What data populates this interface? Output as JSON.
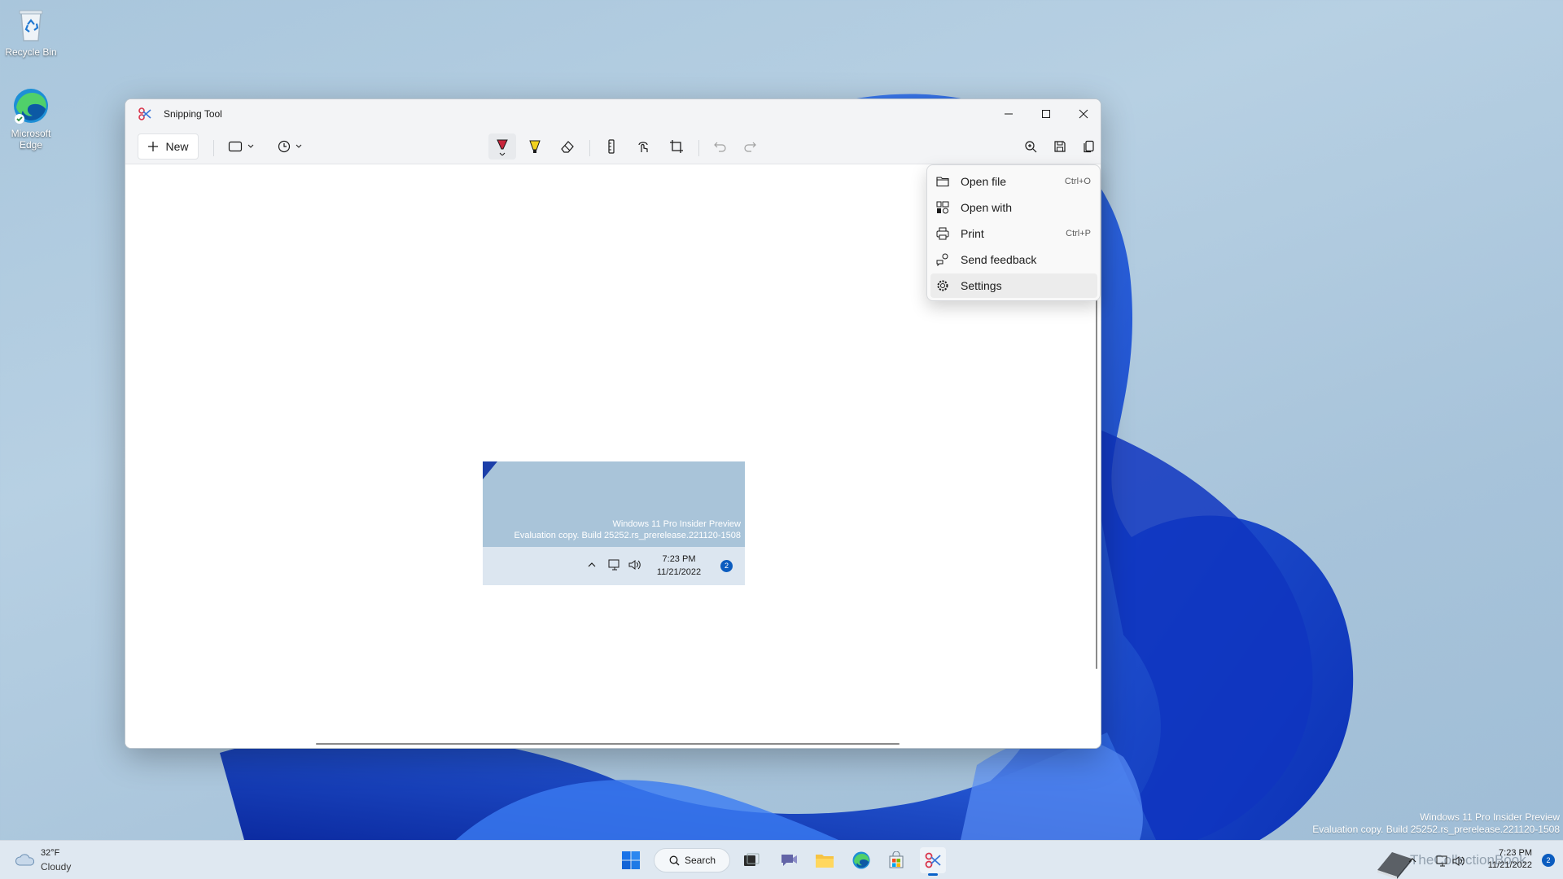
{
  "desktop": {
    "icons": [
      {
        "label": "Recycle Bin",
        "icon": "recycle-bin-icon"
      },
      {
        "label": "Microsoft Edge",
        "icon": "edge-icon"
      }
    ],
    "watermark_line1": "Windows 11 Pro Insider Preview",
    "watermark_line2": "Evaluation copy. Build 25252.rs_prerelease.221120-1508",
    "logo_text": "TheCollectionBook"
  },
  "window": {
    "title": "Snipping Tool",
    "toolbar": {
      "new_label": "New",
      "icons": [
        "snip-mode-icon",
        "delay-timer-icon",
        "ballpoint-pen-icon",
        "highlighter-icon",
        "eraser-icon",
        "ruler-icon",
        "touch-writing-icon",
        "crop-icon",
        "undo-icon",
        "redo-icon",
        "zoom-icon",
        "save-icon",
        "copy-icon",
        "share-icon",
        "more-icon"
      ]
    },
    "capture": {
      "watermark_line1": "Windows 11 Pro Insider Preview",
      "watermark_line2": "Evaluation copy. Build 25252.rs_prerelease.221120-1508",
      "time": "7:23 PM",
      "date": "11/21/2022",
      "badge": "2"
    }
  },
  "menu": {
    "items": [
      {
        "label": "Open file",
        "shortcut": "Ctrl+O",
        "icon": "folder-icon"
      },
      {
        "label": "Open with",
        "shortcut": "",
        "icon": "open-with-icon"
      },
      {
        "label": "Print",
        "shortcut": "Ctrl+P",
        "icon": "printer-icon"
      },
      {
        "label": "Send feedback",
        "shortcut": "",
        "icon": "feedback-icon"
      },
      {
        "label": "Settings",
        "shortcut": "",
        "icon": "gear-icon"
      }
    ]
  },
  "taskbar": {
    "weather_temp": "32°F",
    "weather_condition": "Cloudy",
    "search_label": "Search",
    "time": "7:23 PM",
    "date": "11/21/2022",
    "notification_count": "2"
  },
  "colors": {
    "accent": "#0a62c9",
    "wallpaper_blue": "#1848d8",
    "desktop_bg": "#a9c6dc"
  }
}
